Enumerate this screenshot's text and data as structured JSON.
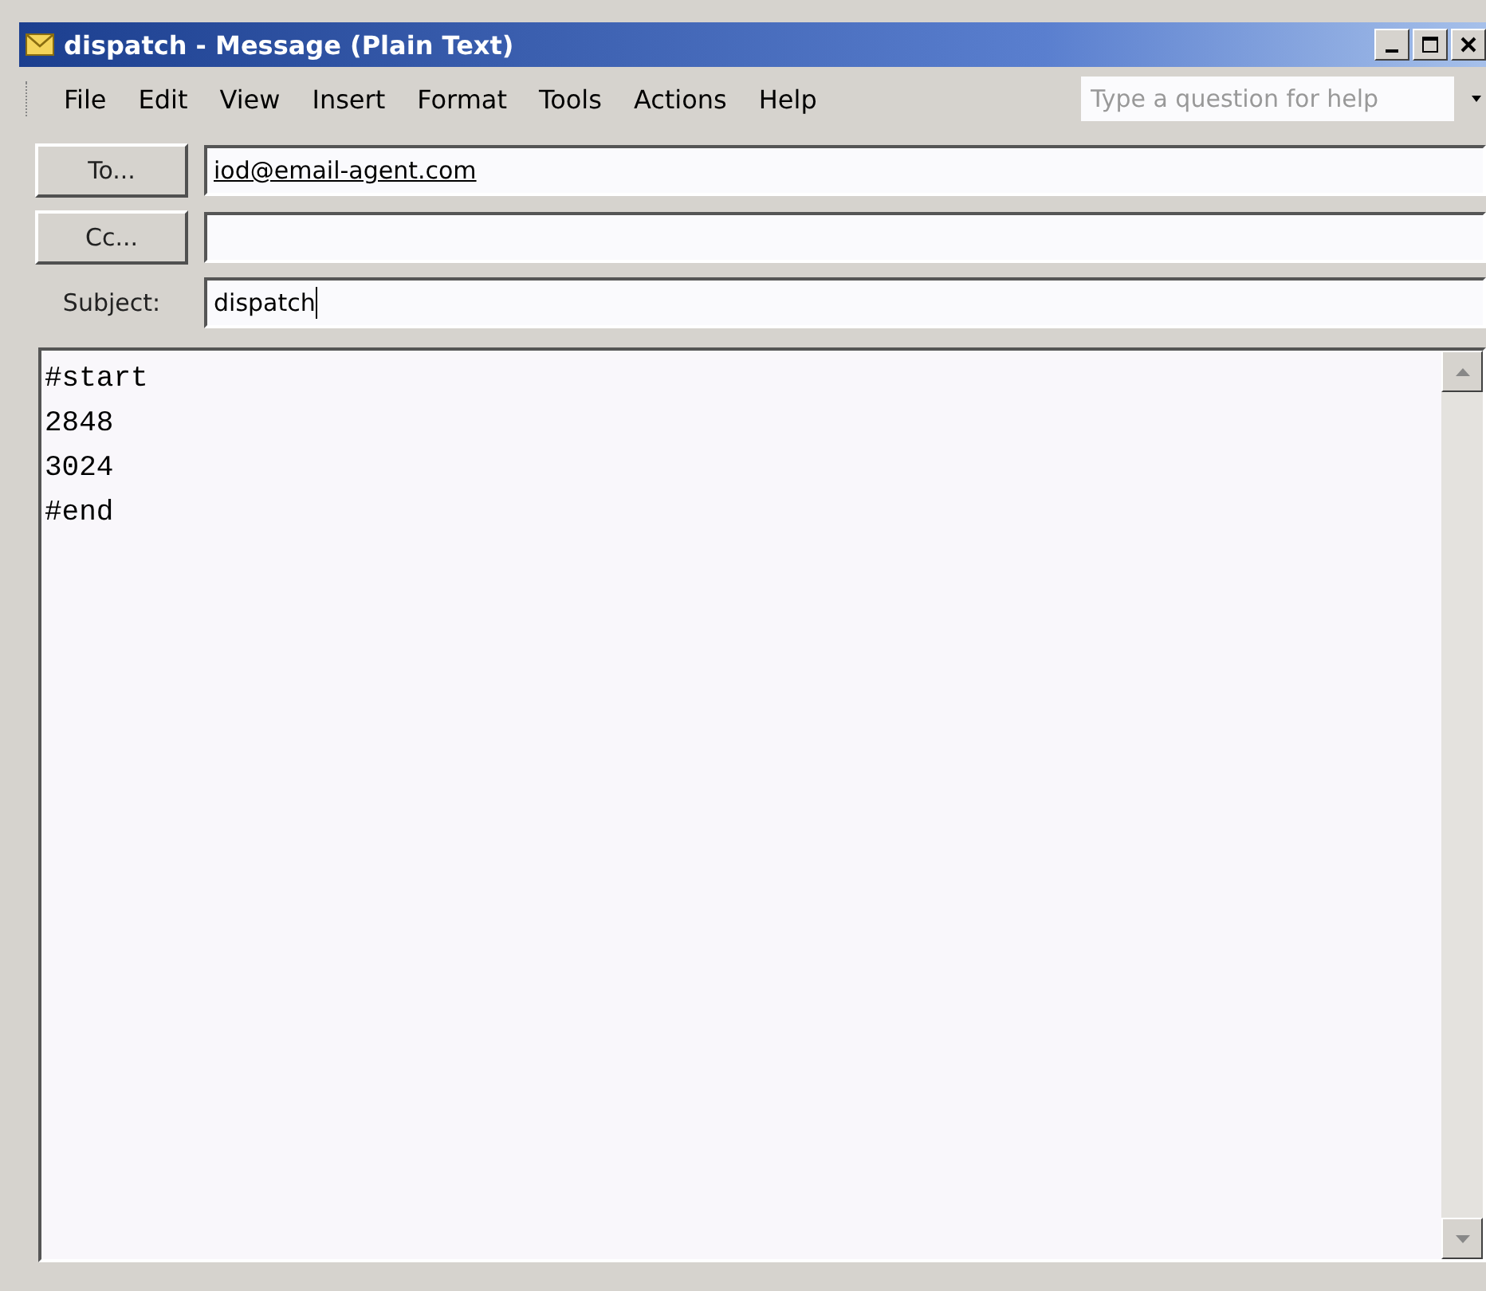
{
  "window": {
    "title": "dispatch - Message (Plain Text)"
  },
  "menu": [
    "File",
    "Edit",
    "View",
    "Insert",
    "Format",
    "Tools",
    "Actions",
    "Help"
  ],
  "help_search": {
    "placeholder": "Type a question for help"
  },
  "to": {
    "label": "To...",
    "value": "iod@email-agent.com"
  },
  "cc": {
    "label": "Cc..."
  },
  "subject": {
    "label": "Subject:",
    "value": "dispatch"
  },
  "body": [
    "#start",
    "2848",
    "3024",
    "#end"
  ]
}
